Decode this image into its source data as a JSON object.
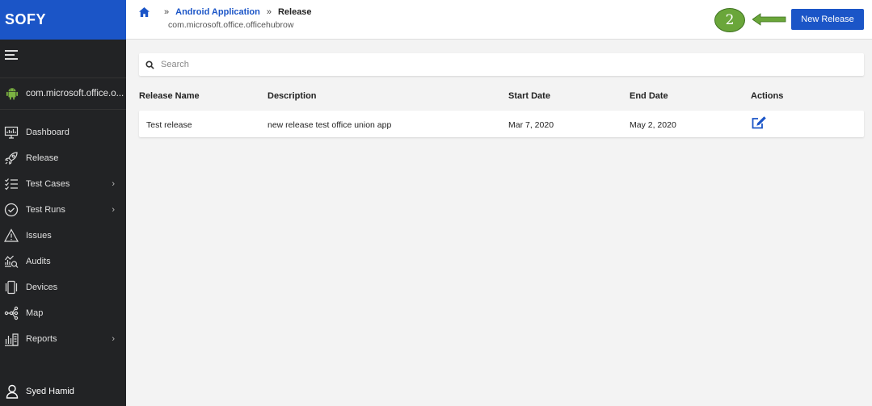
{
  "brand": "SOFY",
  "sidebar": {
    "app_name": "com.microsoft.office.o...",
    "items": [
      {
        "label": "Dashboard",
        "icon": "dashboard-icon",
        "chevron": ""
      },
      {
        "label": "Release",
        "icon": "rocket-icon",
        "chevron": ""
      },
      {
        "label": "Test Cases",
        "icon": "checklist-icon",
        "chevron": "›"
      },
      {
        "label": "Test Runs",
        "icon": "check-circle-icon",
        "chevron": "›"
      },
      {
        "label": "Issues",
        "icon": "warning-icon",
        "chevron": ""
      },
      {
        "label": "Audits",
        "icon": "audit-icon",
        "chevron": ""
      },
      {
        "label": "Devices",
        "icon": "devices-icon",
        "chevron": ""
      },
      {
        "label": "Map",
        "icon": "map-icon",
        "chevron": ""
      },
      {
        "label": "Reports",
        "icon": "reports-icon",
        "chevron": "›"
      }
    ],
    "user": "Syed Hamid"
  },
  "header": {
    "crumb_sep": "»",
    "crumb_app": "Android Application",
    "crumb_current": "Release",
    "subtitle": "com.microsoft.office.officehubrow",
    "step_number": "2",
    "new_release_label": "New Release"
  },
  "search": {
    "placeholder": "Search",
    "value": ""
  },
  "table": {
    "columns": [
      "Release Name",
      "Description",
      "Start Date",
      "End Date",
      "Actions"
    ],
    "rows": [
      {
        "name": "Test release",
        "description": "new release test office union app",
        "start": "Mar 7, 2020",
        "end": "May 2, 2020"
      }
    ]
  },
  "colors": {
    "brand_blue": "#1b55c7",
    "sidebar_bg": "#222325",
    "android_green": "#7cb342",
    "badge_green": "#6aa63a"
  }
}
